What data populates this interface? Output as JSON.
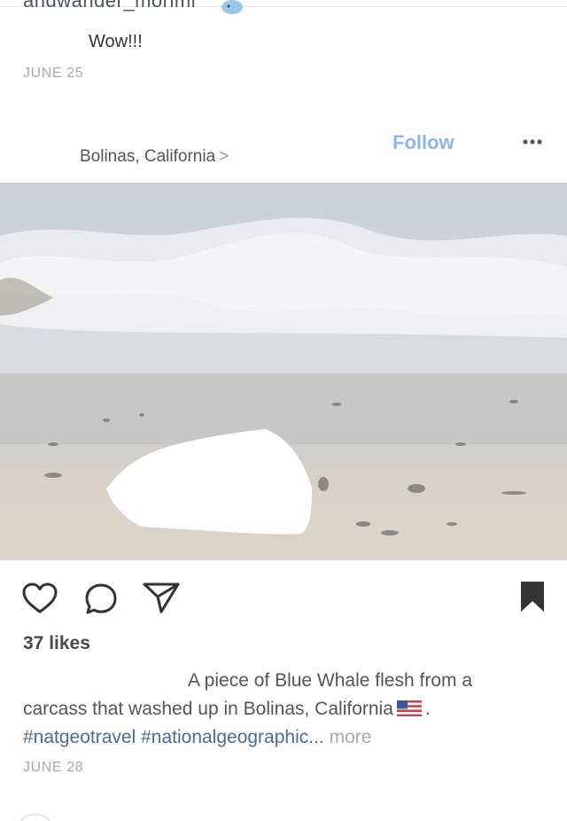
{
  "previous_post": {
    "username_clipped": "andwander_morimi",
    "comment": "Wow!!!",
    "date": "JUNE 25"
  },
  "post": {
    "follow_label": "Follow",
    "location": "Bolinas, California",
    "location_chevron": ">",
    "likes": "37 likes",
    "caption_line1": "A piece of Blue Whale flesh from a",
    "caption_line2": "carcass that washed up in Bolinas, California",
    "caption_dot": ".",
    "hashtags": "#natgeotravel #nationalgeographic",
    "ellipsis": "...",
    "more_label": "more",
    "date": "JUNE 28"
  },
  "icons": [
    "whale-emoji",
    "more-options-dots",
    "heart-icon",
    "comment-icon",
    "share-icon",
    "bookmark-icon",
    "us-flag-emoji"
  ]
}
